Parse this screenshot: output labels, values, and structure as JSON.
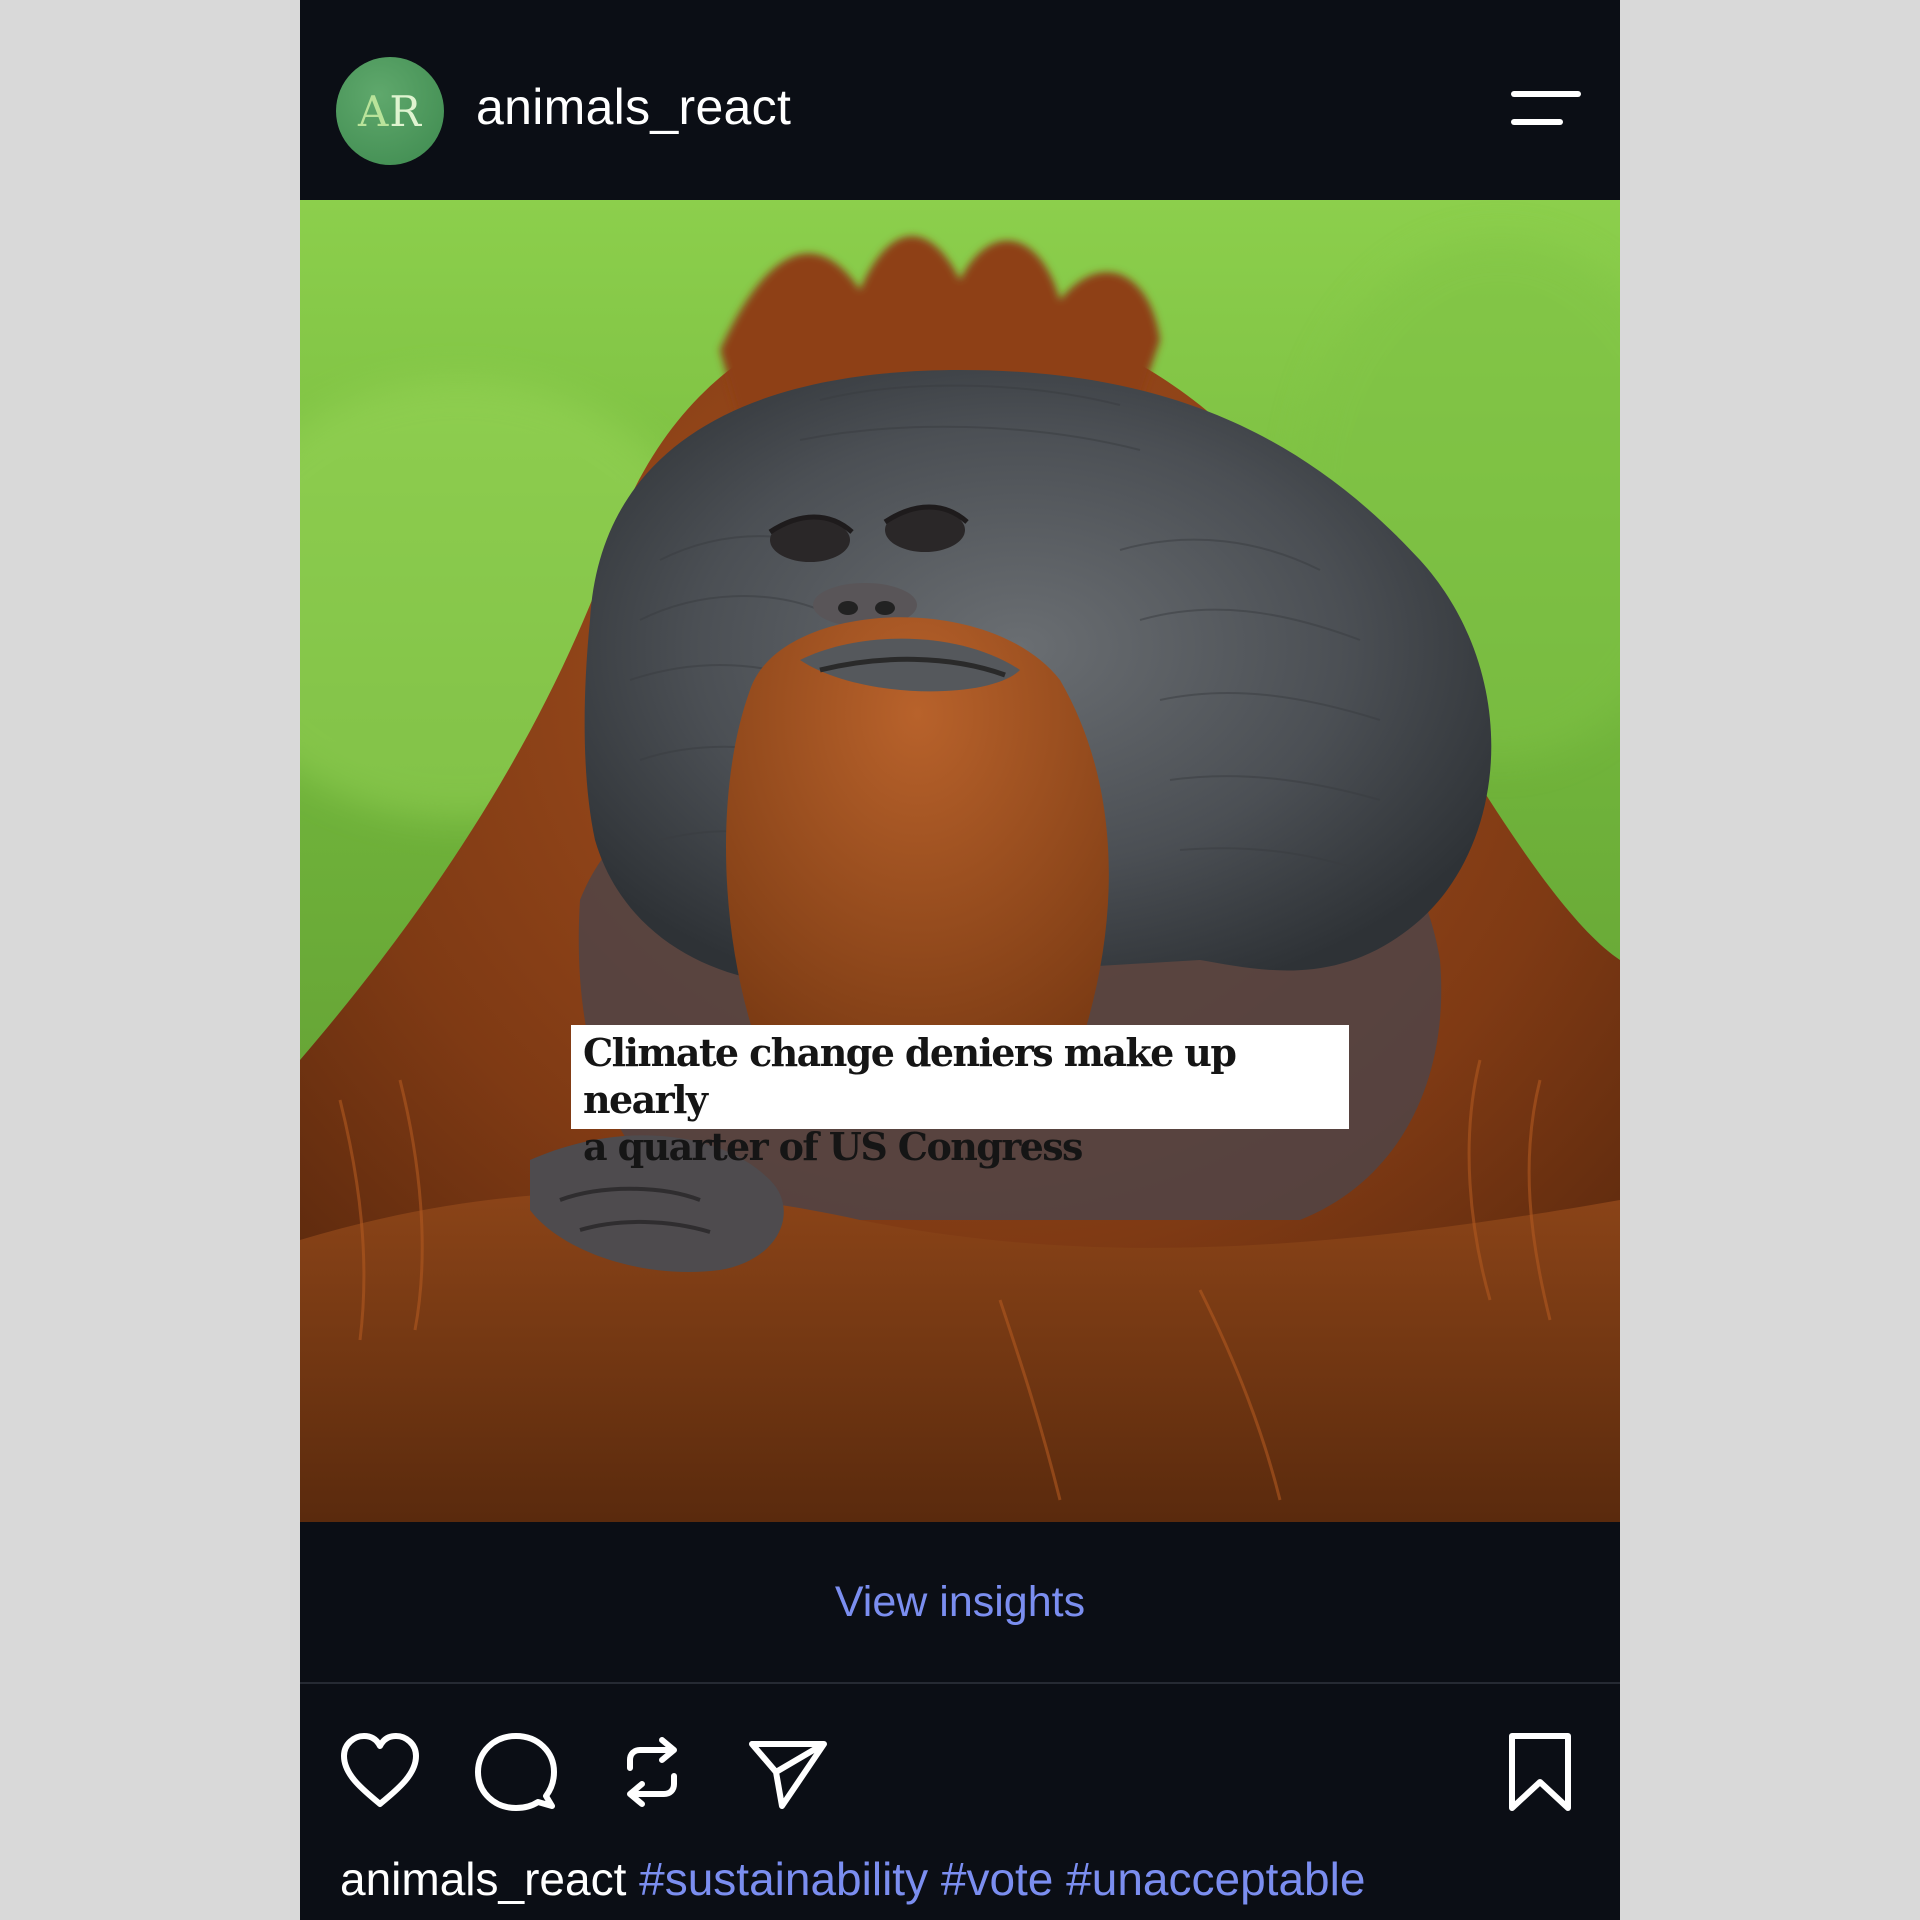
{
  "post": {
    "avatar_initials": [
      "A",
      "R"
    ],
    "username": "animals_react",
    "menu_icon": "hamburger-menu-icon",
    "image_description_icon": "orangutan-photo",
    "headline_line1": "Climate change deniers make up nearly",
    "headline_line2": "a quarter of US Congress",
    "insights_label": "View insights",
    "actions": {
      "like_icon": "heart-icon",
      "comment_icon": "comment-bubble-icon",
      "repost_icon": "repost-icon",
      "share_icon": "send-icon",
      "save_icon": "bookmark-icon"
    },
    "caption": {
      "username": "animals_react",
      "hashtags": [
        "#sustainability",
        "#vote",
        "#unacceptable"
      ]
    }
  },
  "colors": {
    "background": "#0b0e15",
    "page_outer": "#d9d9d9",
    "link_accent": "#7b8ef0",
    "avatar_green": "#4e9a5d"
  }
}
